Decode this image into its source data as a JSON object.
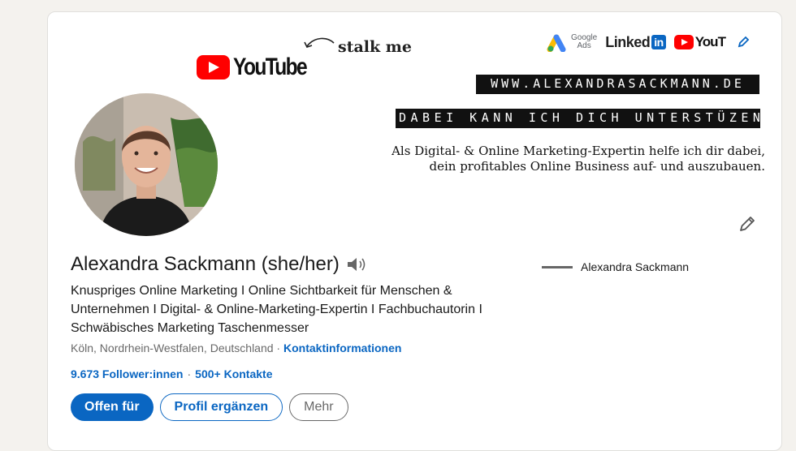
{
  "banner": {
    "youtube_word": "YouTube",
    "stalk_text": "stalk me",
    "google_ads_line1": "Google",
    "google_ads_line2": "Ads",
    "linkedin_word": "Linked",
    "linkedin_box": "in",
    "youtube_small_word": "YouT",
    "url_strip": "WWW.ALEXANDRASACKMANN.DE",
    "slogan_strip": "DABEI KANN ICH DICH UNTERSTÜZEN",
    "tagline_line1": "Als Digital- & Online Marketing-Expertin helfe ich dir dabei,",
    "tagline_line2": "dein profitables Online Business auf- und auszubauen."
  },
  "profile": {
    "name": "Alexandra Sackmann (she/her)",
    "headline": "Knuspriges Online Marketing I Online Sichtbarkeit für Menschen & Unternehmen I Digital- & Online-Marketing-Expertin I Fachbuchautorin I Schwäbisches Marketing Taschenmesser",
    "location": "Köln, Nordrhein-Westfalen, Deutschland",
    "location_separator": " · ",
    "contact_link": "Kontaktinformationen",
    "followers": "9.673 Follower:innen",
    "network_separator": "·",
    "connections": "500+ Kontakte",
    "experience": "Alexandra Sackmann"
  },
  "actions": {
    "open_to": "Offen für",
    "add_section": "Profil ergänzen",
    "more": "Mehr"
  },
  "icons": {
    "name_pronunciation": "speaker-icon",
    "edit_banner": "pencil-icon",
    "edit_intro": "pencil-icon"
  },
  "colors": {
    "linkedin_blue": "#0a66c2",
    "youtube_red": "#ff0000",
    "page_bg": "#f4f2ee"
  }
}
